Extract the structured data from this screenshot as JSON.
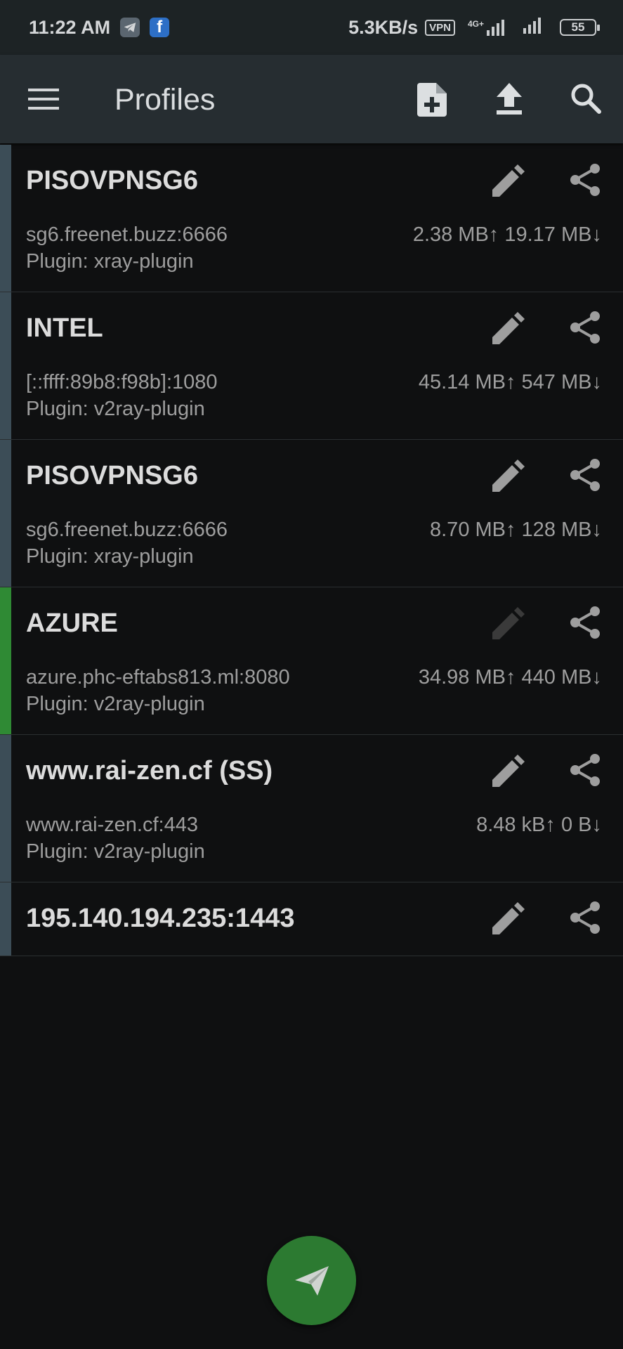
{
  "status_bar": {
    "time": "11:22 AM",
    "net_speed": "5.3KB/s",
    "vpn_label": "VPN",
    "network_type": "4G+",
    "battery": "55",
    "notification_icons": [
      "telegram-icon",
      "facebook-icon"
    ]
  },
  "toolbar": {
    "title": "Profiles",
    "actions": [
      "add-profile-icon",
      "import-icon",
      "search-icon"
    ]
  },
  "profiles": [
    {
      "name": "PISOVPNSG6",
      "address": "sg6.freenet.buzz:6666",
      "plugin": "Plugin: xray-plugin",
      "traffic": "2.38 MB↑  19.17 MB↓",
      "active": false
    },
    {
      "name": "INTEL",
      "address": "[::ffff:89b8:f98b]:1080",
      "plugin": "Plugin: v2ray-plugin",
      "traffic": "45.14 MB↑  547 MB↓",
      "active": false
    },
    {
      "name": "PISOVPNSG6",
      "address": "sg6.freenet.buzz:6666",
      "plugin": "Plugin: xray-plugin",
      "traffic": "8.70 MB↑  128 MB↓",
      "active": false
    },
    {
      "name": "AZURE",
      "address": "azure.phc-eftabs813.ml:8080",
      "plugin": "Plugin: v2ray-plugin",
      "traffic": "34.98 MB↑  440 MB↓",
      "active": true
    },
    {
      "name": "www.rai-zen.cf (SS)",
      "address": "www.rai-zen.cf:443",
      "plugin": "Plugin: v2ray-plugin",
      "traffic": "8.48 kB↑  0 B↓",
      "active": false
    },
    {
      "name": "195.140.194.235:1443",
      "active": false
    }
  ],
  "colors": {
    "active_indicator": "#2f8a34",
    "inactive_indicator": "#3c4d57",
    "fab": "#2c7a31",
    "toolbar": "#262d31"
  },
  "fab_icon": "send-icon"
}
